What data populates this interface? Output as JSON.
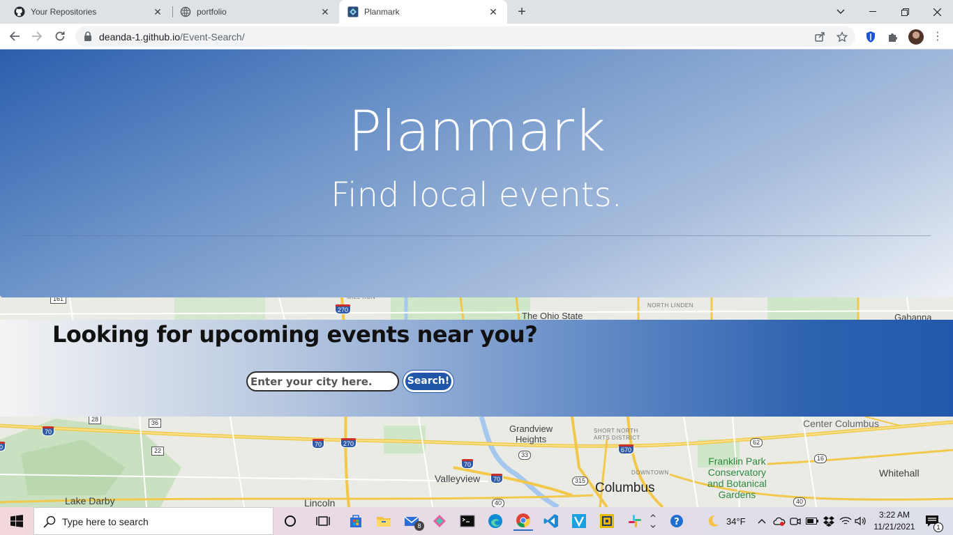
{
  "browser": {
    "tabs": [
      {
        "title": "Your Repositories",
        "icon": "github-icon"
      },
      {
        "title": "portfolio",
        "icon": "globe-icon"
      },
      {
        "title": "Planmark",
        "icon": "planmark-favicon"
      }
    ],
    "url_host": "deanda-1.github.io",
    "url_path": "/Event-Search/"
  },
  "hero": {
    "title": "Planmark",
    "subtitle": "Find local events."
  },
  "search": {
    "heading": "Looking for upcoming events near you?",
    "placeholder": "Enter your city here.",
    "button_label": "Search!"
  },
  "map": {
    "labels": {
      "ohio_state": "The Ohio State",
      "north_linden": "NORTH LINDEN",
      "gahanna": "Gahanna",
      "grandview": "Grandview\nHeights",
      "short_north": "SHORT NORTH\nARTS DISTRICT",
      "center_columbus": "Center Columbus",
      "franklin_park": "Franklin Park\nConservatory\nand Botanical\nGardens",
      "whitehall": "Whitehall",
      "valleyview": "Valleyview",
      "downtown": "DOWNTOWN",
      "columbus": "Columbus",
      "lake_darby": "Lake Darby",
      "lincoln": "Lincoln",
      "mill_run": "MILL RUN"
    },
    "route_numbers": [
      "270",
      "70",
      "70",
      "270",
      "70",
      "70",
      "670",
      "315",
      "33",
      "62",
      "16",
      "40",
      "40",
      "28",
      "36",
      "22",
      "161",
      "70"
    ]
  },
  "taskbar": {
    "search_placeholder": "Type here to search",
    "mail_badge": "8",
    "weather": "34°F",
    "time": "3:22 AM",
    "date": "11/21/2021",
    "notification_count": "1"
  },
  "colors": {
    "hero_start": "#2a5eae",
    "hero_end": "#eef1f6",
    "search_button": "#1f56a8"
  }
}
